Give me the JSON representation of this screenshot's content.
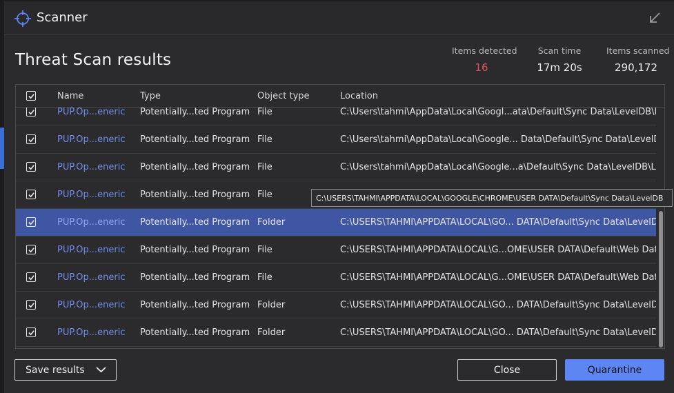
{
  "window": {
    "title": "Scanner"
  },
  "page": {
    "heading": "Threat Scan results"
  },
  "stats": [
    {
      "label": "Items detected",
      "value": "16",
      "color": "#e2515a"
    },
    {
      "label": "Scan time",
      "value": "17m 20s"
    },
    {
      "label": "Items scanned",
      "value": "290,172"
    }
  ],
  "table": {
    "columns": [
      "Name",
      "Type",
      "Object type",
      "Location"
    ],
    "rows": [
      {
        "name": "PUP.Op...eneric",
        "type": "Potentially...ted Program",
        "object_type": "File",
        "location": "C:\\Users\\tahmi\\AppData\\Local\\Googl...ata\\Default\\Sync Data\\LevelDB\\LOCK",
        "checked": true,
        "selected": false
      },
      {
        "name": "PUP.Op...eneric",
        "type": "Potentially...ted Program",
        "object_type": "File",
        "location": "C:\\Users\\tahmi\\AppData\\Local\\Google... Data\\Default\\Sync Data\\LevelDB\\LOG",
        "checked": true,
        "selected": false
      },
      {
        "name": "PUP.Op...eneric",
        "type": "Potentially...ted Program",
        "object_type": "File",
        "location": "C:\\Users\\tahmi\\AppData\\Local\\Google...a\\Default\\Sync Data\\LevelDB\\LOG.old",
        "checked": true,
        "selected": false
      },
      {
        "name": "PUP.Op...eneric",
        "type": "Potentially...ted Program",
        "object_type": "File",
        "location": "",
        "checked": true,
        "selected": false
      },
      {
        "name": "PUP.Op...eneric",
        "type": "Potentially...ted Program",
        "object_type": "Folder",
        "location": "C:\\USERS\\TAHMI\\APPDATA\\LOCAL\\GO... DATA\\Default\\Sync Data\\LevelDB",
        "checked": true,
        "selected": true
      },
      {
        "name": "PUP.Op...eneric",
        "type": "Potentially...ted Program",
        "object_type": "File",
        "location": "C:\\USERS\\TAHMI\\APPDATA\\LOCAL\\G...OME\\USER DATA\\Default\\Web Data",
        "checked": true,
        "selected": false
      },
      {
        "name": "PUP.Op...eneric",
        "type": "Potentially...ted Program",
        "object_type": "File",
        "location": "C:\\USERS\\TAHMI\\APPDATA\\LOCAL\\G...OME\\USER DATA\\Default\\Web Data",
        "checked": true,
        "selected": false
      },
      {
        "name": "PUP.Op...eneric",
        "type": "Potentially...ted Program",
        "object_type": "Folder",
        "location": "C:\\USERS\\TAHMI\\APPDATA\\LOCAL\\GO... DATA\\Default\\Sync Data\\LevelDB",
        "checked": true,
        "selected": false
      },
      {
        "name": "PUP.Op...eneric",
        "type": "Potentially...ted Program",
        "object_type": "Folder",
        "location": "C:\\USERS\\TAHMI\\APPDATA\\LOCAL\\GO... DATA\\Default\\Sync Data\\LevelDB",
        "checked": true,
        "selected": false
      }
    ]
  },
  "tooltip": {
    "text": "C:\\USERS\\TAHMI\\APPDATA\\LOCAL\\GOOGLE\\CHROME\\USER DATA\\Default\\Sync Data\\LevelDB"
  },
  "buttons": {
    "save": "Save results",
    "close": "Close",
    "quarantine": "Quarantine"
  },
  "colors": {
    "accent": "#5d86f4",
    "selected_row": "#3f57a3",
    "detected": "#e2515a",
    "link": "#6f8fe8"
  },
  "icons": {
    "logo": "crosshair-icon",
    "minimize": "minimize-arrow-icon",
    "dropdown": "chevron-down-icon",
    "checkbox": "checkmark-icon"
  }
}
